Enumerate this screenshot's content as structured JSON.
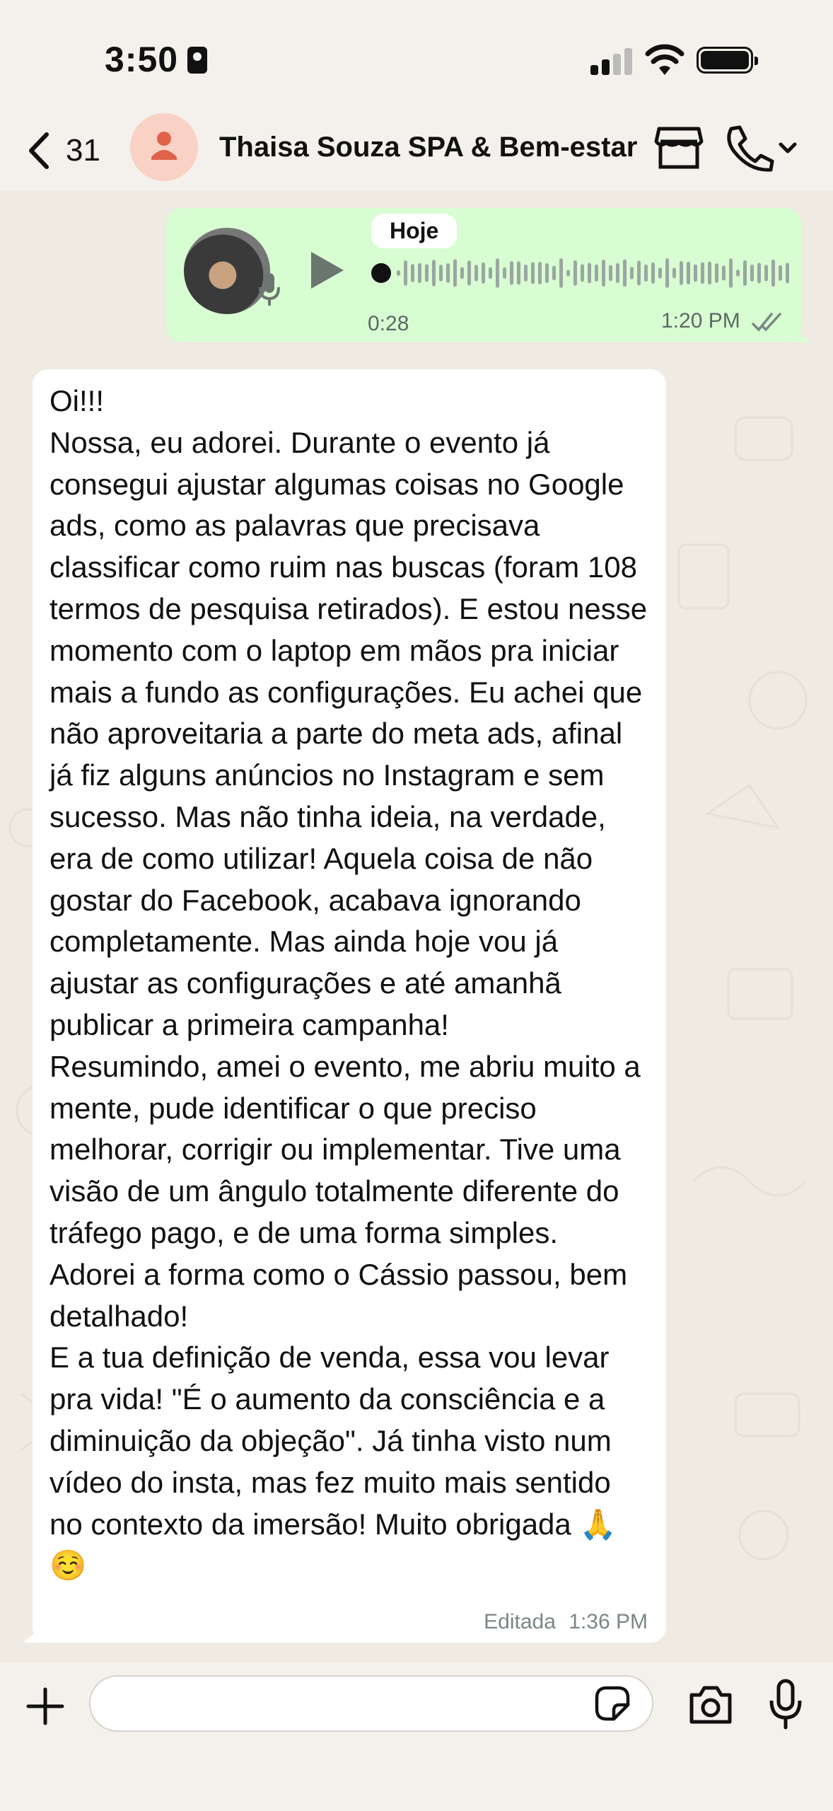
{
  "status_bar": {
    "time": "3:50"
  },
  "header": {
    "back_count": "31",
    "contact_name": "Thaisa Souza SPA & Bem-estar"
  },
  "voice_message": {
    "date_badge": "Hoje",
    "duration": "0:28",
    "time": "1:20 PM",
    "read_status": "double-check-icon"
  },
  "text_message": {
    "body": "Oi!!!\nNossa, eu adorei. Durante o evento já consegui ajustar algumas coisas no Google ads, como as palavras que precisava classificar como ruim nas buscas (foram 108 termos de pesquisa retirados). E estou nesse momento com o laptop em mãos pra iniciar mais a fundo as configurações. Eu achei que não aproveitaria a parte do meta ads, afinal já fiz alguns anúncios no Instagram e sem sucesso. Mas não tinha ideia, na verdade, era de como utilizar! Aquela coisa de não gostar do Facebook, acabava ignorando completamente. Mas ainda hoje vou já ajustar as configurações e até amanhã publicar a primeira campanha!\nResumindo, amei o evento, me abriu muito a mente, pude identificar o que preciso melhorar, corrigir ou implementar. Tive uma visão de um ângulo totalmente diferente do tráfego pago, e de uma forma simples. Adorei a forma como o Cássio passou, bem detalhado!\nE a tua definição de venda, essa vou levar pra vida! \"É o aumento da consciência e a diminuição da objeção\". Já tinha visto num vídeo do insta, mas fez muito mais sentido no contexto da imersão! Muito obrigada 🙏☺️",
    "edited_label": "Editada",
    "time": "1:36 PM"
  },
  "composer": {
    "placeholder": ""
  },
  "colors": {
    "outgoing_bubble": "#d9fdd3",
    "incoming_bubble": "#ffffff",
    "chat_background": "#efeae2",
    "meta_text": "#7b8784"
  }
}
